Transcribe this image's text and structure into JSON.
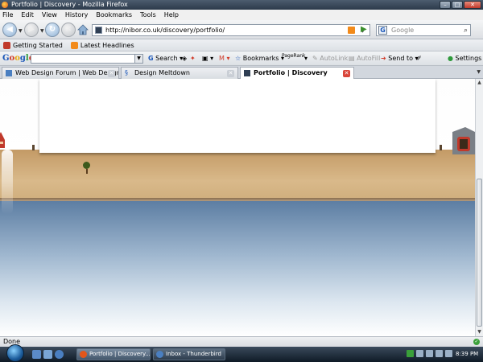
{
  "window": {
    "title": "Portfolio | Discovery - Mozilla Firefox",
    "controls": {
      "minimize": "–",
      "maximize": "□",
      "close": "✕"
    }
  },
  "menu": [
    "File",
    "Edit",
    "View",
    "History",
    "Bookmarks",
    "Tools",
    "Help"
  ],
  "navigation": {
    "url": "http://nibor.co.uk/discovery/portfolio/",
    "search_placeholder": "Google",
    "search_engine_glyph": "G"
  },
  "bookmarks": [
    {
      "label": "Getting Started",
      "color": "#c0392b"
    },
    {
      "label": "Latest Headlines",
      "color": "#f28a1a"
    }
  ],
  "google_toolbar": {
    "logo": "Google",
    "search_label": "Search",
    "bookmarks_label": "Bookmarks",
    "pagerank_label": "PageRank",
    "autolink_label": "AutoLink",
    "autofill_label": "AutoFill",
    "sendto_label": "Send to",
    "settings_label": "Settings"
  },
  "tabs": [
    {
      "label": "Web Design Forum | Web Design C...",
      "active": false
    },
    {
      "label": "Design Meltdown",
      "active": false
    },
    {
      "label": "Portfolio | Discovery",
      "active": true
    }
  ],
  "status": {
    "text": "Done"
  },
  "taskbar": {
    "items": [
      {
        "label": "Portfolio | Discovery...",
        "active": true,
        "color": "#e2561b"
      },
      {
        "label": "Inbox - Thunderbird",
        "active": false,
        "color": "#4a7fc1"
      }
    ],
    "clock": "8:39 PM"
  },
  "colors": {
    "ground": "#d0ad7b",
    "water": "#5d7ea3",
    "close_tab": "#d9453a"
  }
}
